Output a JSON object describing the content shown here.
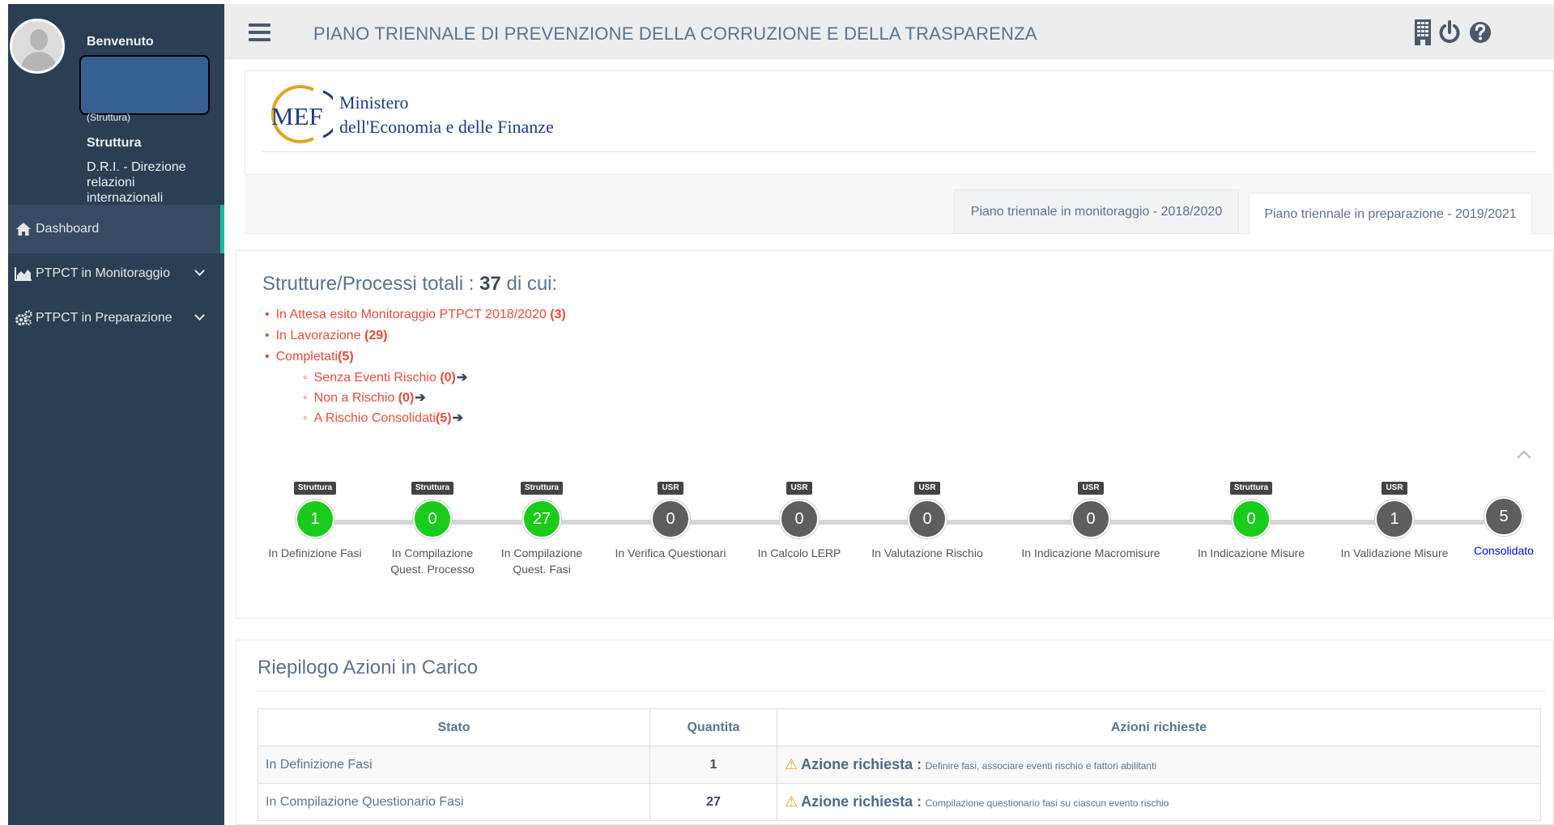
{
  "header": {
    "title": "PIANO TRIENNALE DI PREVENZIONE DELLA CORRUZIONE E DELLA TRASPARENZA",
    "icons": [
      "building-icon",
      "power-icon",
      "help-icon"
    ]
  },
  "sidebar": {
    "welcome": "Benvenuto",
    "profile_small": "(Struttura)",
    "struttura_label": "Struttura",
    "struttura_value": "D.R.I. - Direzione relazioni internazionali",
    "items": [
      {
        "label": "Dashboard",
        "icon": "home-icon"
      },
      {
        "label": "PTPCT in Monitoraggio",
        "icon": "area-chart-icon"
      },
      {
        "label": "PTPCT in Preparazione",
        "icon": "gears-icon"
      }
    ],
    "colors": {
      "bg": "#2a3f54",
      "active_accent": "#1abb9c"
    }
  },
  "logo": {
    "mark": "MEF",
    "line1": "Ministero",
    "line2": "dell'Economia e delle Finanze"
  },
  "tabs": [
    {
      "label": "Piano triennale in monitoraggio - 2018/2020",
      "active": false
    },
    {
      "label": "Piano triennale in preparazione - 2019/2021",
      "active": true
    }
  ],
  "summary": {
    "title_prefix": "Strutture/Processi totali : ",
    "total": "37",
    "title_suffix": " di cui:",
    "items": [
      {
        "label": "In Attesa esito Monitoraggio PTPCT 2018/2020 ",
        "count": "(3)"
      },
      {
        "label": "In Lavorazione ",
        "count": "(29)"
      },
      {
        "label": "Completati",
        "count": "(5)"
      }
    ],
    "subitems": [
      {
        "label": "Senza Eventi Rischio ",
        "count": "(0)"
      },
      {
        "label": "Non a Rischio ",
        "count": "(0)"
      },
      {
        "label": "A Rischio Consolidati",
        "count": "(5)"
      }
    ],
    "arrow": "➔"
  },
  "workflow": [
    {
      "badge": "Struttura",
      "count": "1",
      "color": "green",
      "label": "In Definizione Fasi"
    },
    {
      "badge": "Struttura",
      "count": "0",
      "color": "green",
      "label": "In Compilazione Quest. Processo"
    },
    {
      "badge": "Struttura",
      "count": "27",
      "color": "green",
      "label": "In Compilazione Quest. Fasi"
    },
    {
      "badge": "USR",
      "count": "0",
      "color": "grey",
      "label": "In Verifica Questionari"
    },
    {
      "badge": "USR",
      "count": "0",
      "color": "grey",
      "label": "In Calcolo LERP"
    },
    {
      "badge": "USR",
      "count": "0",
      "color": "grey",
      "label": "In Valutazione Rischio"
    },
    {
      "badge": "USR",
      "count": "0",
      "color": "grey",
      "label": "In Indicazione Macromisure"
    },
    {
      "badge": "Struttura",
      "count": "0",
      "color": "green",
      "label": "In Indicazione Misure"
    },
    {
      "badge": "USR",
      "count": "1",
      "color": "grey",
      "label": "In Validazione Misure"
    },
    {
      "badge": "",
      "count": "5",
      "color": "grey",
      "label": "Consolidato"
    }
  ],
  "riepilogo": {
    "title": "Riepilogo Azioni in Carico",
    "columns": [
      "Stato",
      "Quantita",
      "Azioni richieste"
    ],
    "rows": [
      {
        "stato": "In Definizione Fasi",
        "quantita": "1",
        "azione_label": "Azione richiesta :",
        "azione_text": "Definire fasi, associare eventi rischio e fattori abilitanti"
      },
      {
        "stato": "In Compilazione Questionario Fasi",
        "quantita": "27",
        "azione_label": "Azione richiesta :",
        "azione_text": "Compilazione questionario fasi su ciascun evento rischio"
      }
    ]
  }
}
